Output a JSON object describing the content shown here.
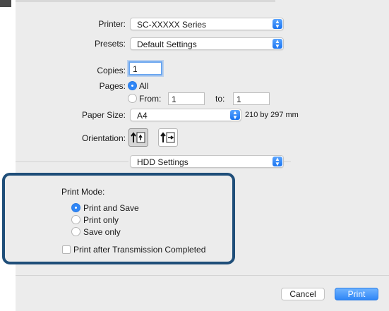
{
  "printer": {
    "label": "Printer:",
    "value": "SC-XXXXX Series"
  },
  "presets": {
    "label": "Presets:",
    "value": "Default Settings"
  },
  "copies": {
    "label": "Copies:",
    "value": "1"
  },
  "pages": {
    "label": "Pages:",
    "all_label": "All",
    "from_label": "From:",
    "from_value": "1",
    "to_label": "to:",
    "to_value": "1",
    "selected": "All"
  },
  "paper_size": {
    "label": "Paper Size:",
    "value": "A4",
    "dimensions": "210 by 297 mm"
  },
  "orientation": {
    "label": "Orientation:",
    "selected": "portrait"
  },
  "section_popup": {
    "value": "HDD Settings"
  },
  "print_mode": {
    "label": "Print Mode:",
    "options": [
      "Print and Save",
      "Print only",
      "Save only"
    ],
    "selected": "Print and Save"
  },
  "print_after": {
    "label": "Print after Transmission Completed",
    "checked": false
  },
  "buttons": {
    "cancel": "Cancel",
    "print": "Print"
  },
  "colors": {
    "accent": "#2f86f6",
    "highlight_border": "#1f4e79"
  }
}
